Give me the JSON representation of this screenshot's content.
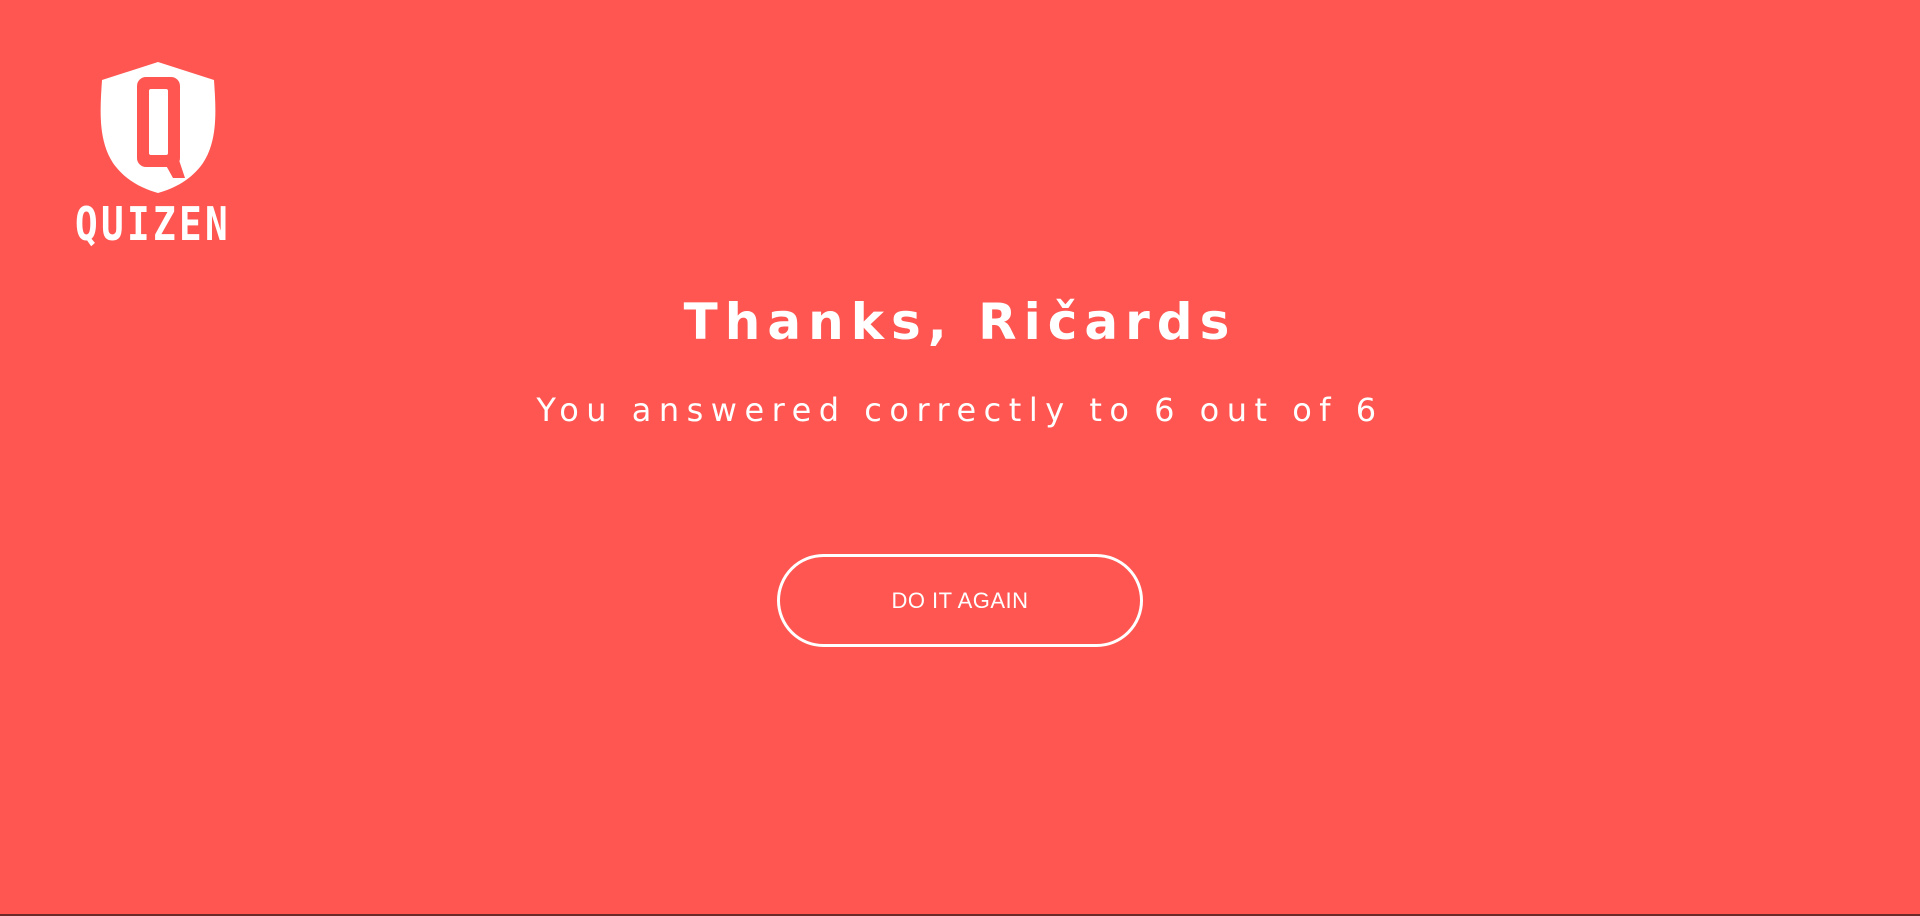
{
  "brand": {
    "logo_text": "QUIZEN",
    "logo_icon": "shield-q-icon",
    "background_color": "#ff5651",
    "foreground_color": "#ffffff"
  },
  "result": {
    "title": "Thanks, Ričards",
    "summary": "You answered correctly to 6 out of 6"
  },
  "actions": {
    "retry_label": "DO IT AGAIN"
  }
}
